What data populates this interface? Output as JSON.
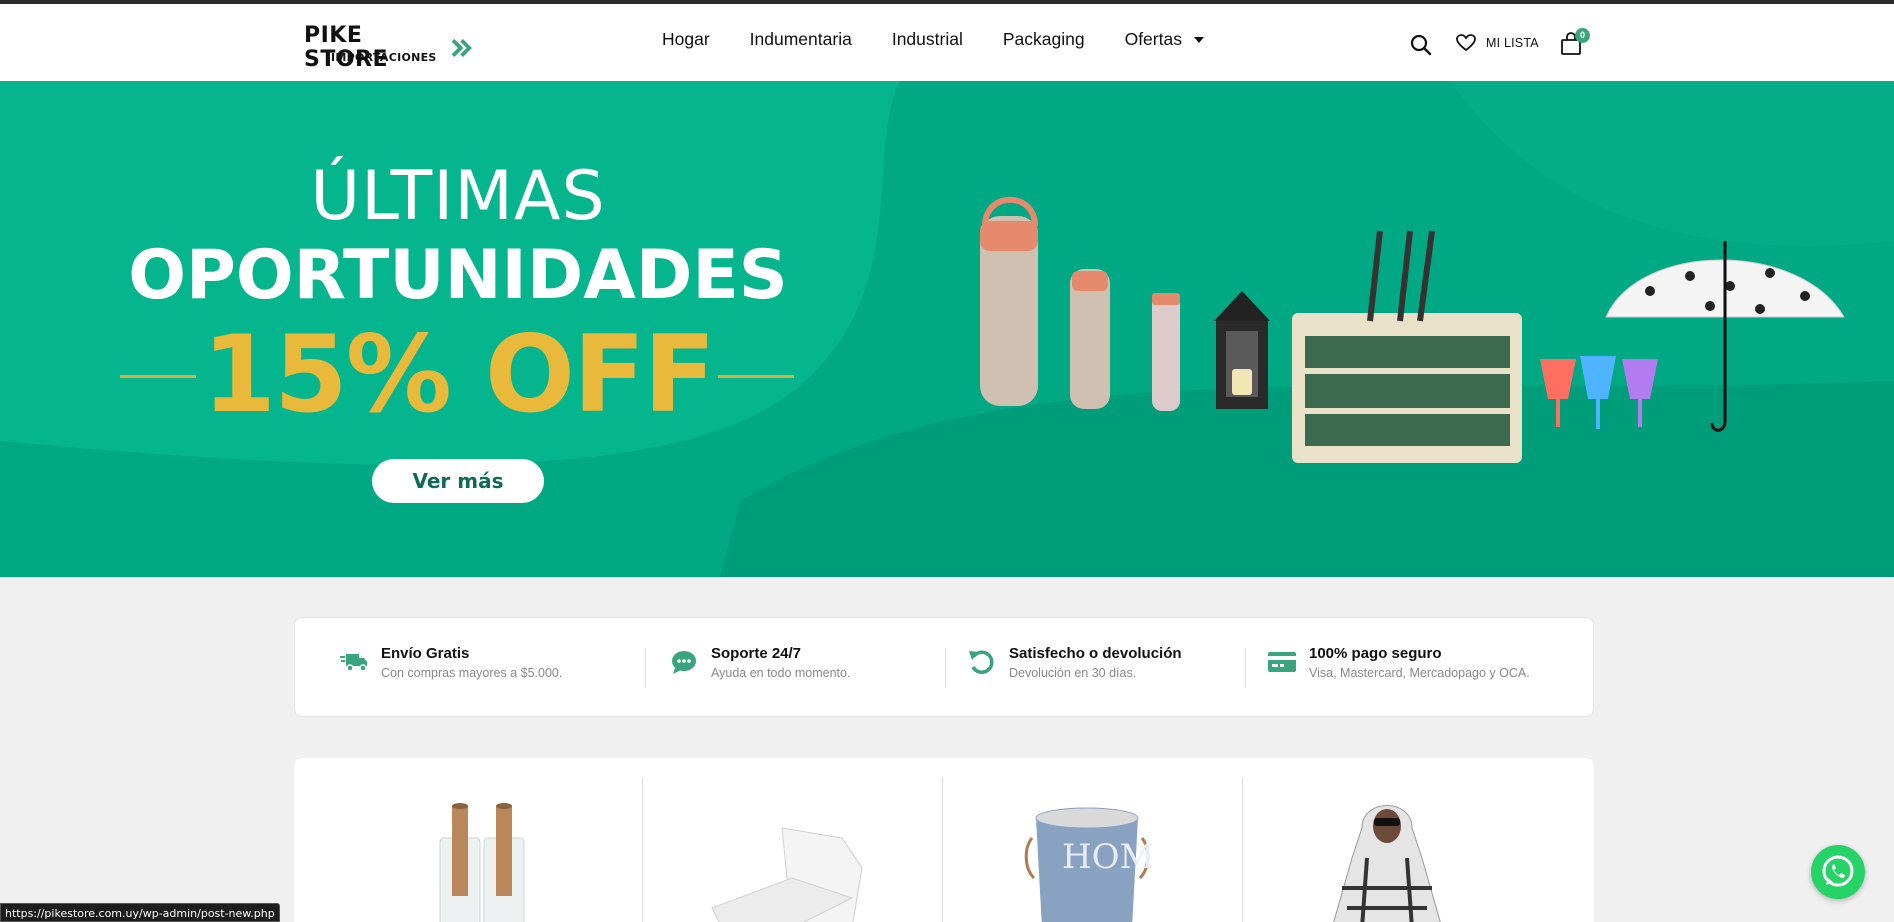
{
  "header": {
    "logo_main": "PIKE STORE",
    "logo_sub": "IMPORTACIONES",
    "nav": [
      {
        "label": "Hogar"
      },
      {
        "label": "Indumentaria"
      },
      {
        "label": "Industrial"
      },
      {
        "label": "Packaging"
      },
      {
        "label": "Ofertas",
        "has_dropdown": true
      }
    ],
    "wishlist_label": "MI LISTA",
    "cart_count": "0",
    "icons": [
      "search-icon",
      "heart-icon",
      "shopping-bag-icon"
    ]
  },
  "hero": {
    "line1": "ÚLTIMAS",
    "line2": "OPORTUNIDADES",
    "line3": "15% OFF",
    "button_label": "Ver más",
    "colors": {
      "background": "#00a884",
      "accent": "#e8b93a"
    }
  },
  "features": [
    {
      "icon": "truck-icon",
      "title": "Envío Gratis",
      "subtitle": "Con compras mayores a $5.000."
    },
    {
      "icon": "chat-icon",
      "title": "Soporte 24/7",
      "subtitle": "Ayuda en todo momento."
    },
    {
      "icon": "undo-icon",
      "title": "Satisfecho o devolución",
      "subtitle": "Devolución en 30 días."
    },
    {
      "icon": "credit-card-icon",
      "title": "100% pago seguro",
      "subtitle": "Visa, Mastercard, Mercadopago y OCA."
    }
  ],
  "products": [
    {
      "name": "stretch-film-rolls"
    },
    {
      "name": "clamshell-container"
    },
    {
      "name": "laundry-basket",
      "text": "HOM"
    },
    {
      "name": "plaid-hoodie-blanket"
    }
  ],
  "status_bar": {
    "url": "https://pikestore.com.uy/wp-admin/post-new.php"
  },
  "accent_color": "#3aa57d"
}
